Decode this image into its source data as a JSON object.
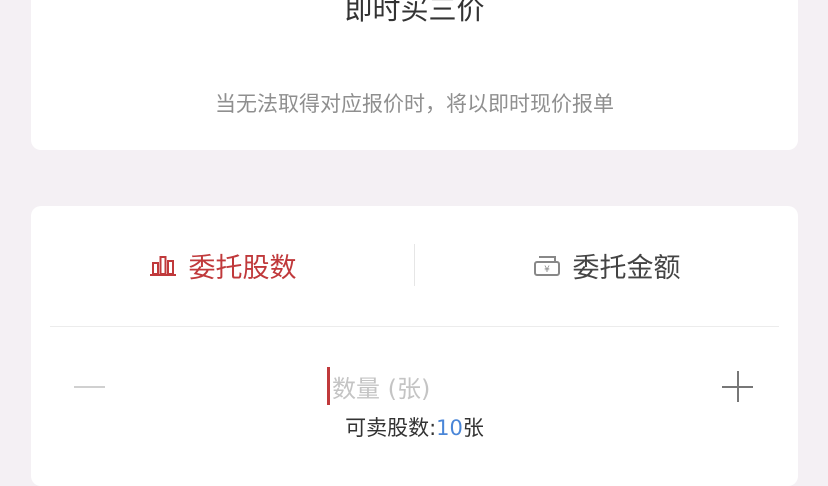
{
  "order_price": {
    "title": "即时买三价",
    "note": "当无法取得对应报价时，将以即时现价报单"
  },
  "entrust": {
    "tabs": [
      {
        "label": "委托股数",
        "icon": "bar-chart-icon",
        "active": true
      },
      {
        "label": "委托金额",
        "icon": "money-box-icon",
        "active": false
      }
    ],
    "quantity_placeholder": "数量 (张)",
    "available_prefix": "可卖股数:",
    "available_value": "10",
    "available_unit": "张"
  },
  "colors": {
    "accent": "#c0393b",
    "link_number": "#4a86d8",
    "background": "#f4f0f4"
  }
}
